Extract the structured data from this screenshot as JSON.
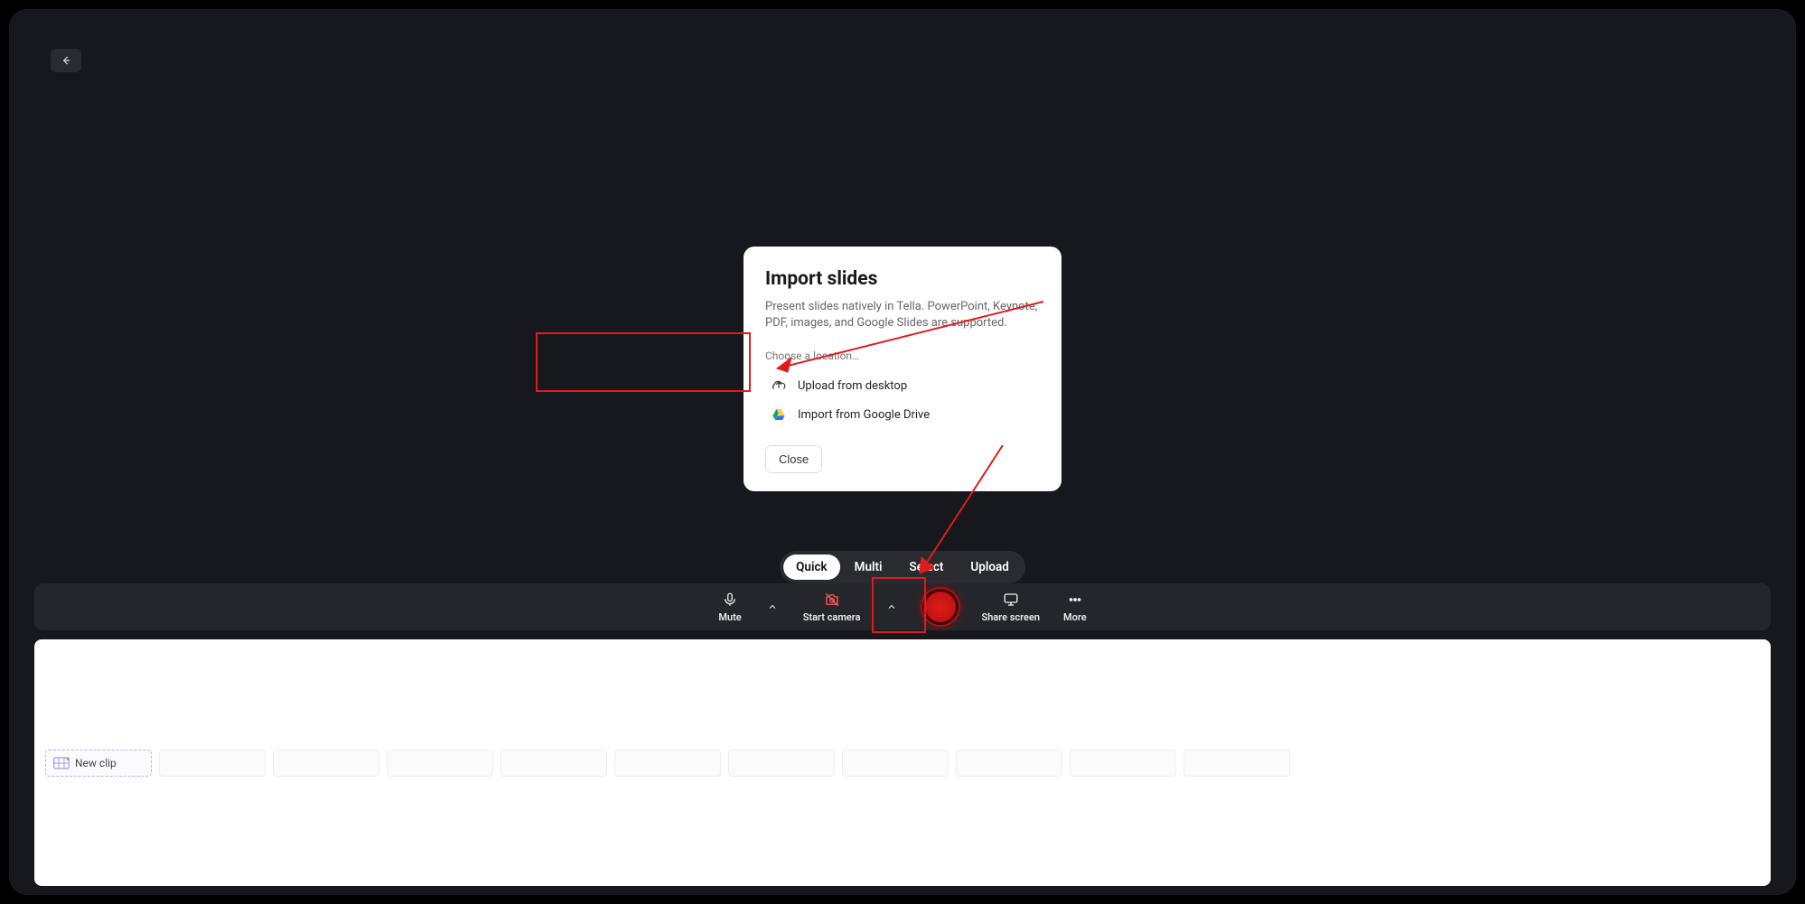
{
  "dialog": {
    "title": "Import slides",
    "description": "Present slides natively in Tella. PowerPoint, Keynote, PDF, images, and Google Slides are supported.",
    "choose_label": "Choose a location…",
    "upload_label": "Upload from desktop",
    "gdrive_label": "Import from Google Drive",
    "close_label": "Close"
  },
  "modes": {
    "quick": "Quick",
    "multi": "Multi",
    "select": "Select",
    "upload": "Upload"
  },
  "toolbar": {
    "mute": "Mute",
    "camera": "Start camera",
    "share": "Share screen",
    "more": "More"
  },
  "strip": {
    "new_clip": "New clip"
  }
}
